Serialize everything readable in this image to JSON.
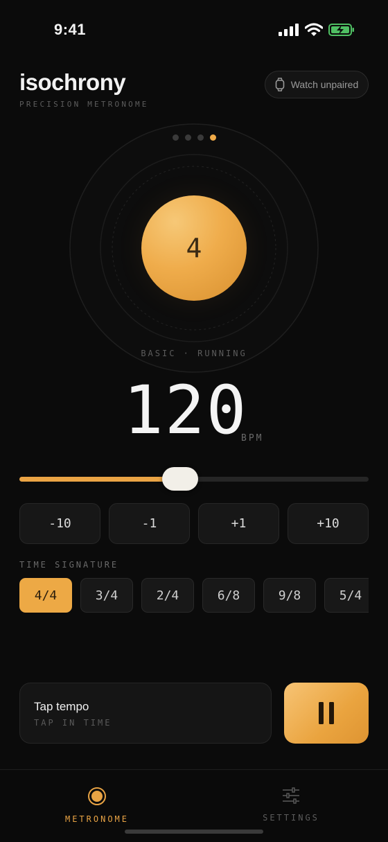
{
  "status_bar": {
    "time": "9:41",
    "icons": [
      "cellular-icon",
      "wifi-icon",
      "battery-charging-icon"
    ]
  },
  "header": {
    "title": "isochrony",
    "subtitle": "PRECISION METRONOME",
    "watch_label": "Watch unpaired",
    "watch_icon": "watch-icon"
  },
  "dial": {
    "beats_per_bar": 4,
    "current_beat": 4,
    "beat_display": "4",
    "status": "BASIC · RUNNING"
  },
  "tempo": {
    "bpm": "120",
    "unit": "BPM",
    "slider_fraction": 0.46
  },
  "steps": [
    "-10",
    "-1",
    "+1",
    "+10"
  ],
  "time_signature": {
    "label": "TIME SIGNATURE",
    "options": [
      "4/4",
      "3/4",
      "2/4",
      "6/8",
      "9/8",
      "5/4"
    ],
    "selected": "4/4"
  },
  "tap_tempo": {
    "title": "Tap tempo",
    "subtitle": "TAP IN TIME"
  },
  "play_button": {
    "state": "playing",
    "icon": "pause-icon"
  },
  "tabs": [
    {
      "label": "METRONOME",
      "icon": "metronome-icon",
      "active": true
    },
    {
      "label": "SETTINGS",
      "icon": "sliders-icon",
      "active": false
    }
  ],
  "colors": {
    "accent": "#eda945",
    "background": "#0b0b0b",
    "surface": "#171717",
    "muted": "#5c5c5c"
  }
}
